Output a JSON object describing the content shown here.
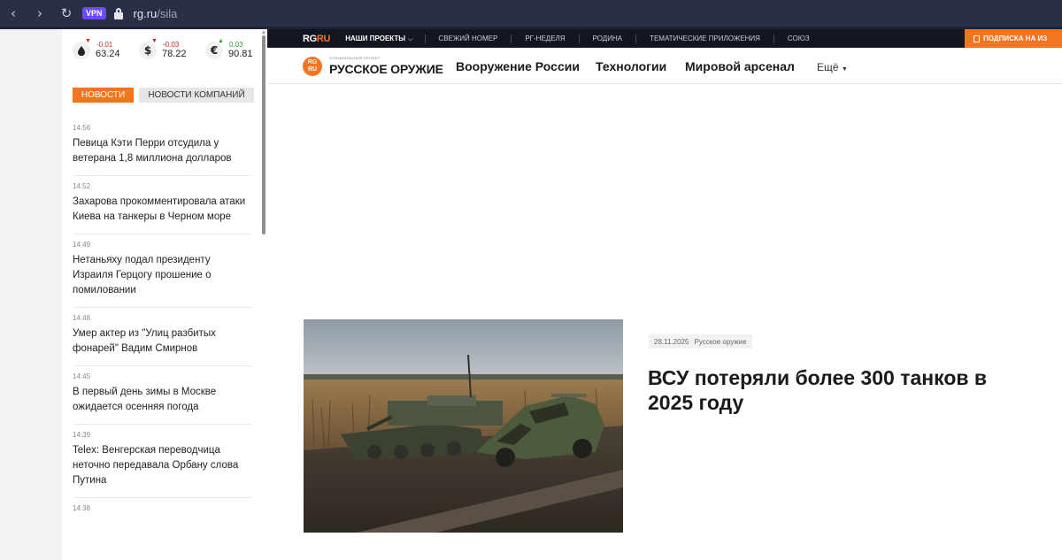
{
  "browser": {
    "vpn_label": "VPN",
    "url_host": "rg.ru",
    "url_path": "/sila"
  },
  "rates": [
    {
      "symbol": "⚫",
      "change": "-0.01",
      "value": "63.24",
      "direction": "down"
    },
    {
      "symbol": "$",
      "change": "-0.03",
      "value": "78.22",
      "direction": "down"
    },
    {
      "symbol": "€",
      "change": "0.03",
      "value": "90.81",
      "direction": "up"
    }
  ],
  "sidebar": {
    "tab_news": "Новости",
    "tab_company": "Новости компаний",
    "news": [
      {
        "time": "14:56",
        "title": "Певица Кэти Перри отсудила у ветерана 1,8 миллиона долларов"
      },
      {
        "time": "14:52",
        "title": "Захарова прокомментировала атаки Киева на танкеры в Черном море"
      },
      {
        "time": "14:49",
        "title": "Нетаньяху подал президенту Израиля Герцогу прошение о помиловании"
      },
      {
        "time": "14:48",
        "title": "Умер актер из \"Улиц разбитых фонарей\" Вадим Смирнов"
      },
      {
        "time": "14:45",
        "title": "В первый день зимы в Москве ожидается осенняя погода"
      },
      {
        "time": "14:39",
        "title": "Telex: Венгерская переводчица неточно передавала Орбану слова Путина"
      },
      {
        "time": "14:38",
        "title": ""
      }
    ]
  },
  "topstrip": {
    "logo_rg": "RG",
    "logo_ru": "RU",
    "projects": "НАШИ ПРОЕКТЫ",
    "links": [
      "СВЕЖИЙ НОМЕР",
      "РГ-НЕДЕЛЯ",
      "РОДИНА",
      "ТЕМАТИЧЕСКИЕ ПРИЛОЖЕНИЯ",
      "СОЮЗ"
    ],
    "subscribe": "ПОДПИСКА НА ИЗ"
  },
  "sitenav": {
    "logo_line1": "RG",
    "logo_line2": "RU",
    "brand_sub": "специальный проект",
    "brand_name": "РУССКОЕ ОРУЖИЕ",
    "links": [
      "Вооружение России",
      "Технологии",
      "Мировой арсенал"
    ],
    "more": "Ещё"
  },
  "article": {
    "date": "28.11.2025",
    "source": "Русское оружие",
    "title": "ВСУ потеряли более 300 танков в 2025 году"
  },
  "colors": {
    "accent": "#f47420",
    "down": "#d11f26",
    "up": "#2e9b3a"
  }
}
